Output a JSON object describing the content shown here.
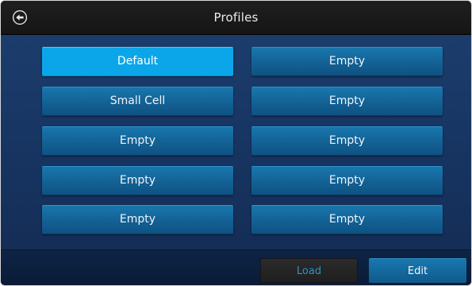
{
  "header": {
    "title": "Profiles",
    "back_icon": "back-arrow-icon"
  },
  "profiles": [
    {
      "label": "Default",
      "selected": true
    },
    {
      "label": "Empty",
      "selected": false
    },
    {
      "label": "Small Cell",
      "selected": false
    },
    {
      "label": "Empty",
      "selected": false
    },
    {
      "label": "Empty",
      "selected": false
    },
    {
      "label": "Empty",
      "selected": false
    },
    {
      "label": "Empty",
      "selected": false
    },
    {
      "label": "Empty",
      "selected": false
    },
    {
      "label": "Empty",
      "selected": false
    },
    {
      "label": "Empty",
      "selected": false
    }
  ],
  "footer": {
    "load_label": "Load",
    "edit_label": "Edit"
  },
  "colors": {
    "accent": "#0ba6ea",
    "button_blue": "#135f92",
    "title_bar": "#1a1a1a",
    "background": "#183664",
    "disabled_text": "#2c93c9"
  }
}
